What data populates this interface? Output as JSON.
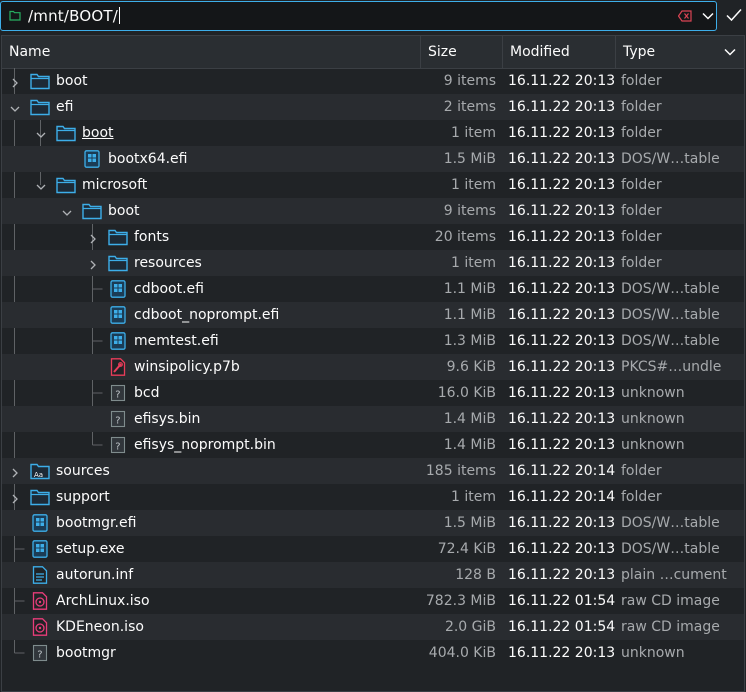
{
  "location": {
    "path": "/mnt/BOOT/",
    "icons": {
      "folder": "folder-icon",
      "clear": "clear-text-icon",
      "history": "chevron-down-icon",
      "accept": "checkmark-icon"
    }
  },
  "columns": [
    "Name",
    "Size",
    "Modified",
    "Type"
  ],
  "header_menu_icon": "chevron-down-icon",
  "colors": {
    "background": "#202326",
    "alt_row": "#292c30",
    "accent": "#3daee9",
    "dim_text": "#a7aaad",
    "efi_icon": "#3daee9",
    "iso_icon": "#e93d7a",
    "cert_icon": "#e93d5a"
  },
  "rows": [
    {
      "name": "boot",
      "size": "9 items",
      "modified": "16.11.22 20:13",
      "type": "folder",
      "depth": 0,
      "icon": "folder-icon",
      "expander": "collapsed"
    },
    {
      "name": "efi",
      "size": "2 items",
      "modified": "16.11.22 20:13",
      "type": "folder",
      "depth": 0,
      "icon": "folder-icon",
      "expander": "expanded"
    },
    {
      "name": "boot",
      "size": "1 item",
      "modified": "16.11.22 20:13",
      "type": "folder",
      "depth": 1,
      "icon": "folder-icon",
      "expander": "expanded",
      "selected": true
    },
    {
      "name": "bootx64.efi",
      "size": "1.5 MiB",
      "modified": "16.11.22 20:13",
      "type": "DOS/W…table",
      "depth": 2,
      "icon": "executable-icon"
    },
    {
      "name": "microsoft",
      "size": "1 item",
      "modified": "16.11.22 20:13",
      "type": "folder",
      "depth": 1,
      "icon": "folder-icon",
      "expander": "expanded"
    },
    {
      "name": "boot",
      "size": "9 items",
      "modified": "16.11.22 20:13",
      "type": "folder",
      "depth": 2,
      "icon": "folder-icon",
      "expander": "expanded"
    },
    {
      "name": "fonts",
      "size": "20 items",
      "modified": "16.11.22 20:13",
      "type": "folder",
      "depth": 3,
      "icon": "folder-icon",
      "expander": "collapsed"
    },
    {
      "name": "resources",
      "size": "1 item",
      "modified": "16.11.22 20:13",
      "type": "folder",
      "depth": 3,
      "icon": "folder-icon",
      "expander": "collapsed"
    },
    {
      "name": "cdboot.efi",
      "size": "1.1 MiB",
      "modified": "16.11.22 20:13",
      "type": "DOS/W…table",
      "depth": 3,
      "icon": "executable-icon"
    },
    {
      "name": "cdboot_noprompt.efi",
      "size": "1.1 MiB",
      "modified": "16.11.22 20:13",
      "type": "DOS/W…table",
      "depth": 3,
      "icon": "executable-icon"
    },
    {
      "name": "memtest.efi",
      "size": "1.3 MiB",
      "modified": "16.11.22 20:13",
      "type": "DOS/W…table",
      "depth": 3,
      "icon": "executable-icon"
    },
    {
      "name": "winsipolicy.p7b",
      "size": "9.6 KiB",
      "modified": "16.11.22 20:13",
      "type": "PKCS#…undle",
      "depth": 3,
      "icon": "certificate-icon"
    },
    {
      "name": "bcd",
      "size": "16.0 KiB",
      "modified": "16.11.22 20:13",
      "type": "unknown",
      "depth": 3,
      "icon": "unknown-file-icon"
    },
    {
      "name": "efisys.bin",
      "size": "1.4 MiB",
      "modified": "16.11.22 20:13",
      "type": "unknown",
      "depth": 3,
      "icon": "unknown-file-icon"
    },
    {
      "name": "efisys_noprompt.bin",
      "size": "1.4 MiB",
      "modified": "16.11.22 20:13",
      "type": "unknown",
      "depth": 3,
      "icon": "unknown-file-icon"
    },
    {
      "name": "sources",
      "size": "185 items",
      "modified": "16.11.22 20:14",
      "type": "folder",
      "depth": 0,
      "icon": "fonts-folder-icon",
      "expander": "collapsed"
    },
    {
      "name": "support",
      "size": "1 item",
      "modified": "16.11.22 20:14",
      "type": "folder",
      "depth": 0,
      "icon": "folder-icon",
      "expander": "collapsed"
    },
    {
      "name": "bootmgr.efi",
      "size": "1.5 MiB",
      "modified": "16.11.22 20:13",
      "type": "DOS/W…table",
      "depth": 0,
      "icon": "executable-icon"
    },
    {
      "name": "setup.exe",
      "size": "72.4 KiB",
      "modified": "16.11.22 20:13",
      "type": "DOS/W…table",
      "depth": 0,
      "icon": "executable-icon"
    },
    {
      "name": "autorun.inf",
      "size": "128 B",
      "modified": "16.11.22 20:13",
      "type": "plain …cument",
      "depth": 0,
      "icon": "text-file-icon"
    },
    {
      "name": "ArchLinux.iso",
      "size": "782.3 MiB",
      "modified": "16.11.22 01:54",
      "type": "raw CD image",
      "depth": 0,
      "icon": "disc-image-icon"
    },
    {
      "name": "KDEneon.iso",
      "size": "2.0 GiB",
      "modified": "16.11.22 01:54",
      "type": "raw CD image",
      "depth": 0,
      "icon": "disc-image-icon"
    },
    {
      "name": "bootmgr",
      "size": "404.0 KiB",
      "modified": "16.11.22 20:13",
      "type": "unknown",
      "depth": 0,
      "icon": "unknown-file-icon"
    }
  ]
}
